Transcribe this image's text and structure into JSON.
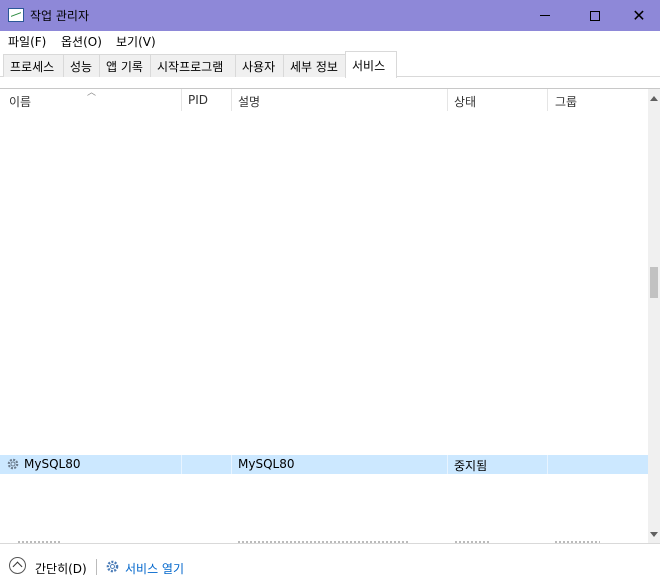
{
  "window": {
    "title": "작업 관리자"
  },
  "menu": [
    "파일(F)",
    "옵션(O)",
    "보기(V)"
  ],
  "tabs": [
    "프로세스",
    "성능",
    "앱 기록",
    "시작프로그램",
    "사용자",
    "세부 정보",
    "서비스"
  ],
  "active_tab": "서비스",
  "columns": [
    "이름",
    "PID",
    "설명",
    "상태",
    "그룹"
  ],
  "selected_row": {
    "name": "MySQL80",
    "pid": "",
    "description": "MySQL80",
    "status": "중지됨",
    "group": ""
  },
  "footer": {
    "fewer_details": "간단히(D)",
    "open_services": "서비스 열기"
  },
  "colors": {
    "titlebar": "#8e88d8",
    "selection": "#cce8ff",
    "link": "#0066cc"
  }
}
